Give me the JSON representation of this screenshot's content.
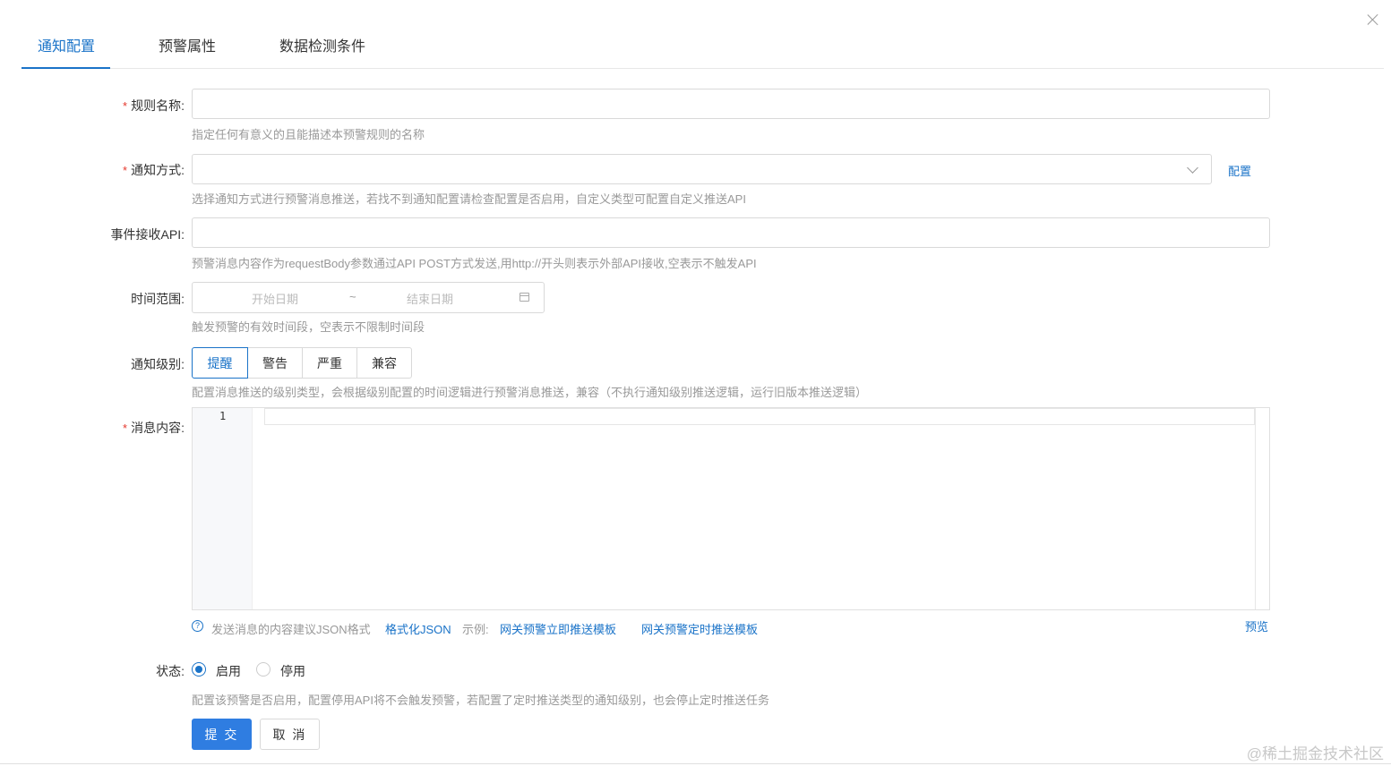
{
  "tabs": [
    "通知配置",
    "预警属性",
    "数据检测条件"
  ],
  "form": {
    "rule_name": {
      "label": "规则名称:",
      "value": "",
      "help": "指定任何有意义的且能描述本预警规则的名称"
    },
    "notify_method": {
      "label": "通知方式:",
      "value": "",
      "config_link": "配置",
      "help": "选择通知方式进行预警消息推送，若找不到通知配置请检查配置是否启用，自定义类型可配置自定义推送API"
    },
    "event_api": {
      "label": "事件接收API:",
      "value": "",
      "help": "预警消息内容作为requestBody参数通过API POST方式发送,用http://开头则表示外部API接收,空表示不触发API"
    },
    "time_range": {
      "label": "时间范围:",
      "start_placeholder": "开始日期",
      "separator": "~",
      "end_placeholder": "结束日期",
      "help": "触发预警的有效时间段，空表示不限制时间段"
    },
    "notify_level": {
      "label": "通知级别:",
      "options": [
        "提醒",
        "警告",
        "严重",
        "兼容"
      ],
      "selected": "提醒",
      "help": "配置消息推送的级别类型，会根据级别配置的时间逻辑进行预警消息推送，兼容（不执行通知级别推送逻辑，运行旧版本推送逻辑）"
    },
    "message": {
      "label": "消息内容:",
      "line_number": "1",
      "hint": "发送消息的内容建议JSON格式",
      "format_link": "格式化JSON",
      "example_label": "示例:",
      "template1": "网关预警立即推送模板",
      "template2": "网关预警定时推送模板",
      "preview": "预览"
    },
    "status": {
      "label": "状态:",
      "options": [
        "启用",
        "停用"
      ],
      "selected": "启用",
      "help": "配置该预警是否启用，配置停用API将不会触发预警，若配置了定时推送类型的通知级别，也会停止定时推送任务"
    }
  },
  "buttons": {
    "submit": "提 交",
    "cancel": "取 消"
  },
  "watermark": "@稀土掘金技术社区",
  "colors": {
    "accent": "#1a73c8",
    "primary_button": "#2f7de1",
    "required": "#e5372c",
    "help_text": "#999999"
  }
}
